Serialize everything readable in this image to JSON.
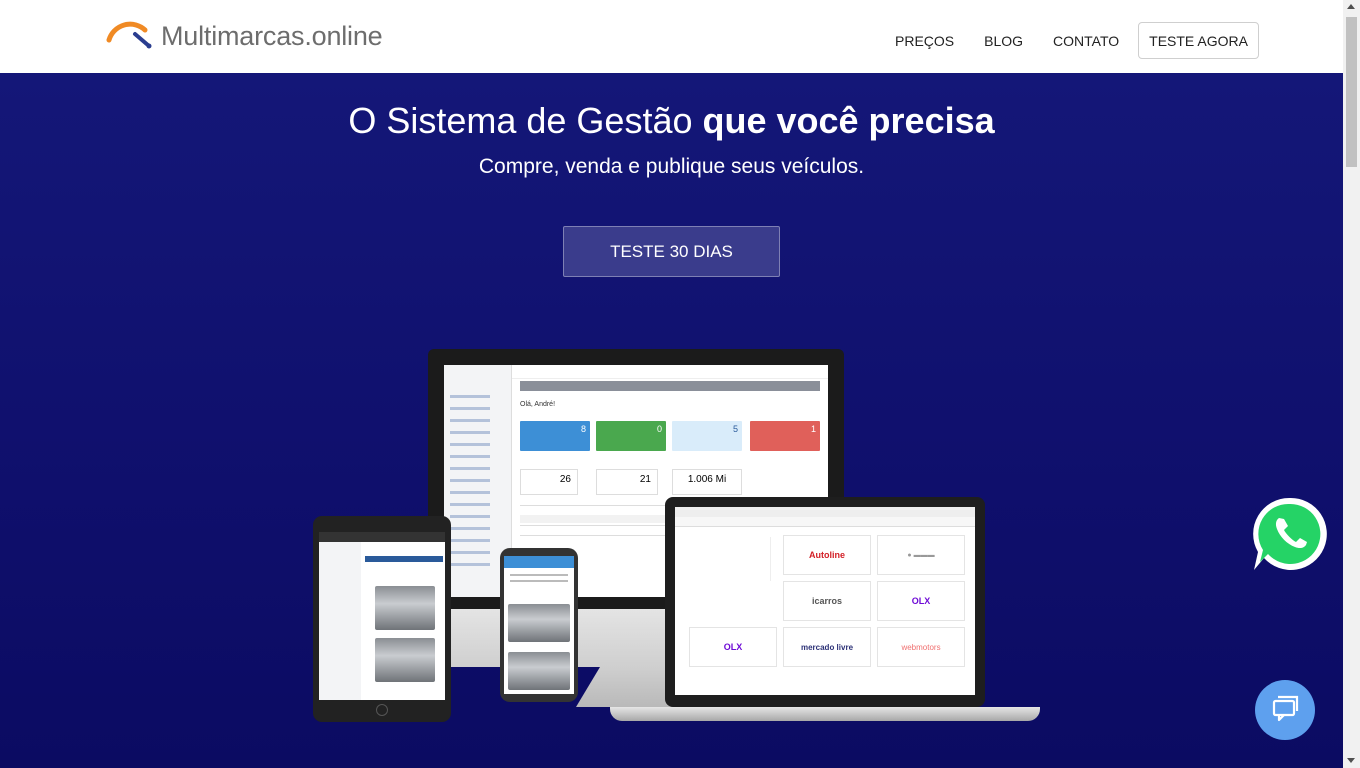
{
  "header": {
    "logo_text": "Multimarcas.online",
    "nav": [
      {
        "label": "PREÇOS"
      },
      {
        "label": "BLOG"
      },
      {
        "label": "CONTATO"
      }
    ],
    "cta_label": "TESTE AGORA"
  },
  "hero": {
    "title_regular": "O Sistema de Gestão ",
    "title_bold": "que você precisa",
    "subtitle": "Compre, venda e publique seus veículos.",
    "cta_label": "TESTE 30 DIAS",
    "background": "#12146f"
  },
  "mockup": {
    "dashboard": {
      "greeting": "Olá, André!",
      "tiles": [
        {
          "value": "8",
          "color": "#3d8fd6"
        },
        {
          "value": "0",
          "color": "#4aa84e"
        },
        {
          "value": "5",
          "color": "#d9ecfa"
        },
        {
          "value": "1",
          "color": "#e0605a"
        }
      ],
      "stats": [
        {
          "value": "26"
        },
        {
          "value": "21"
        },
        {
          "value": "1.006 Mi"
        }
      ]
    },
    "integrations": [
      {
        "name": "Autoline",
        "color": "#d32027"
      },
      {
        "name": "icarros",
        "color": "#555555"
      },
      {
        "name": "OLX",
        "color": "#6e0ad6"
      },
      {
        "name": "OLX",
        "color": "#6e0ad6"
      },
      {
        "name": "mercado livre",
        "color": "#2d3277"
      },
      {
        "name": "webmotors",
        "color": "#f07070"
      }
    ]
  },
  "colors": {
    "accent_orange": "#f08a24",
    "accent_blue": "#2a3d8f",
    "whatsapp_green": "#25d366",
    "chat_blue": "#5ea0ee"
  }
}
